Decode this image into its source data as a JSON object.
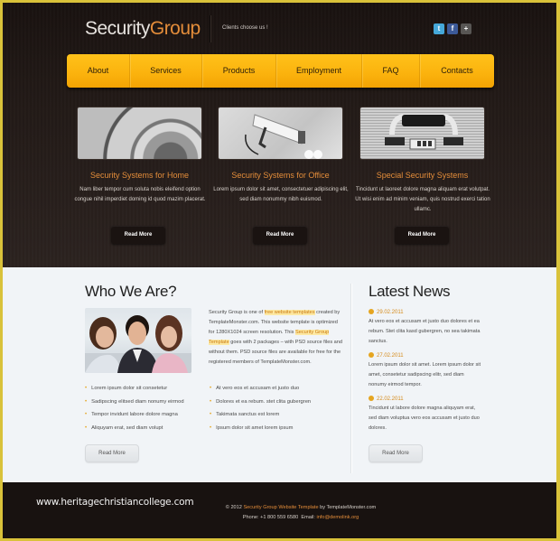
{
  "header": {
    "logo_part1": "Security",
    "logo_part2": "Group",
    "slogan": "Clients choose us !",
    "social": [
      {
        "name": "twitter",
        "glyph": "t"
      },
      {
        "name": "facebook",
        "glyph": "f"
      },
      {
        "name": "plus",
        "glyph": "+"
      }
    ]
  },
  "nav": {
    "items": [
      "About",
      "Services",
      "Products",
      "Employment",
      "FAQ",
      "Contacts"
    ]
  },
  "features": [
    {
      "title": "Security Systems for Home",
      "text": "Nam liber tempor cum soluta nobis eleifend option congue nihil imperdiet doming id quod mazim placerat.",
      "button": "Read More"
    },
    {
      "title": "Security Systems for Office",
      "text": "Lorem ipsum dolor sit amet, consectetuer adipiscing elit, sed diam nonummy nibh euismod.",
      "button": "Read More"
    },
    {
      "title": "Special Security Systems",
      "text": "Tincidunt ut laoreet dolore magna aliquam erat volutpat. Ut wisi enim ad minim veniam, quis nostrud exerci tation ullamc.",
      "button": "Read More"
    }
  ],
  "about": {
    "heading": "Who We Are?",
    "text_1": "Security Group is one of ",
    "link_1": "free website templates",
    "text_2": " created by TemplateMonster.com. This website template is optimized for 1280X1024 screen resolution. This ",
    "link_2": "Security Group Template",
    "text_3": " goes with 2 packages – with PSD source files and without them. PSD source files are available for free for the registered members of TemplateMonster.com.",
    "list_left": [
      "Lorem ipsum dolor sit consetetur",
      "Sadipscing elitsed diam nonumy eirmod",
      "Tempor invidunt labore dolore magna",
      "Aliquyam erat, sed diam volupt"
    ],
    "list_right": [
      "At vero eos et accusam et justo duo",
      "Dolores et ea rebum. stet clita gubergren",
      "Takimata sanctus est lorem",
      "Ipsum dolor sit amet lorem ipsum"
    ],
    "button": "Read More"
  },
  "news": {
    "heading": "Latest News",
    "items": [
      {
        "date": "29.02.2011",
        "text": "At vero eos et accusam et justo duo dolores et ea rebum. Stet clita kasd gubergren, no sea takimata sanctus."
      },
      {
        "date": "27.02.2011",
        "text": "Lorem ipsum dolor sit amet. Lorem ipsum dolor sit amet, consetetur sadipscing elitr, sed diam nonumy eirmod tempor."
      },
      {
        "date": "22.02.2011",
        "text": "Tincidunt ut labore dolore magna aliquyam erat, sed diam voluptua vero eos accusam et justo duo dolores."
      }
    ],
    "button": "Read More"
  },
  "footer": {
    "watermark": "www.heritagechristiancollege.com",
    "copy_prefix": "© 2012 ",
    "copy_link": "Security Group Website Template",
    "copy_suffix": " by TemplateMonster.com",
    "phone_label": "Phone: +1 800 559 6580",
    "email_label": "Email: ",
    "email": "info@demolink.org"
  },
  "colors": {
    "accent_orange": "#e48d3a",
    "nav_yellow": "#fbb20d",
    "frame_border": "#d9c23a",
    "dark_bg": "#211916",
    "light_bg": "#f1f4f7"
  }
}
